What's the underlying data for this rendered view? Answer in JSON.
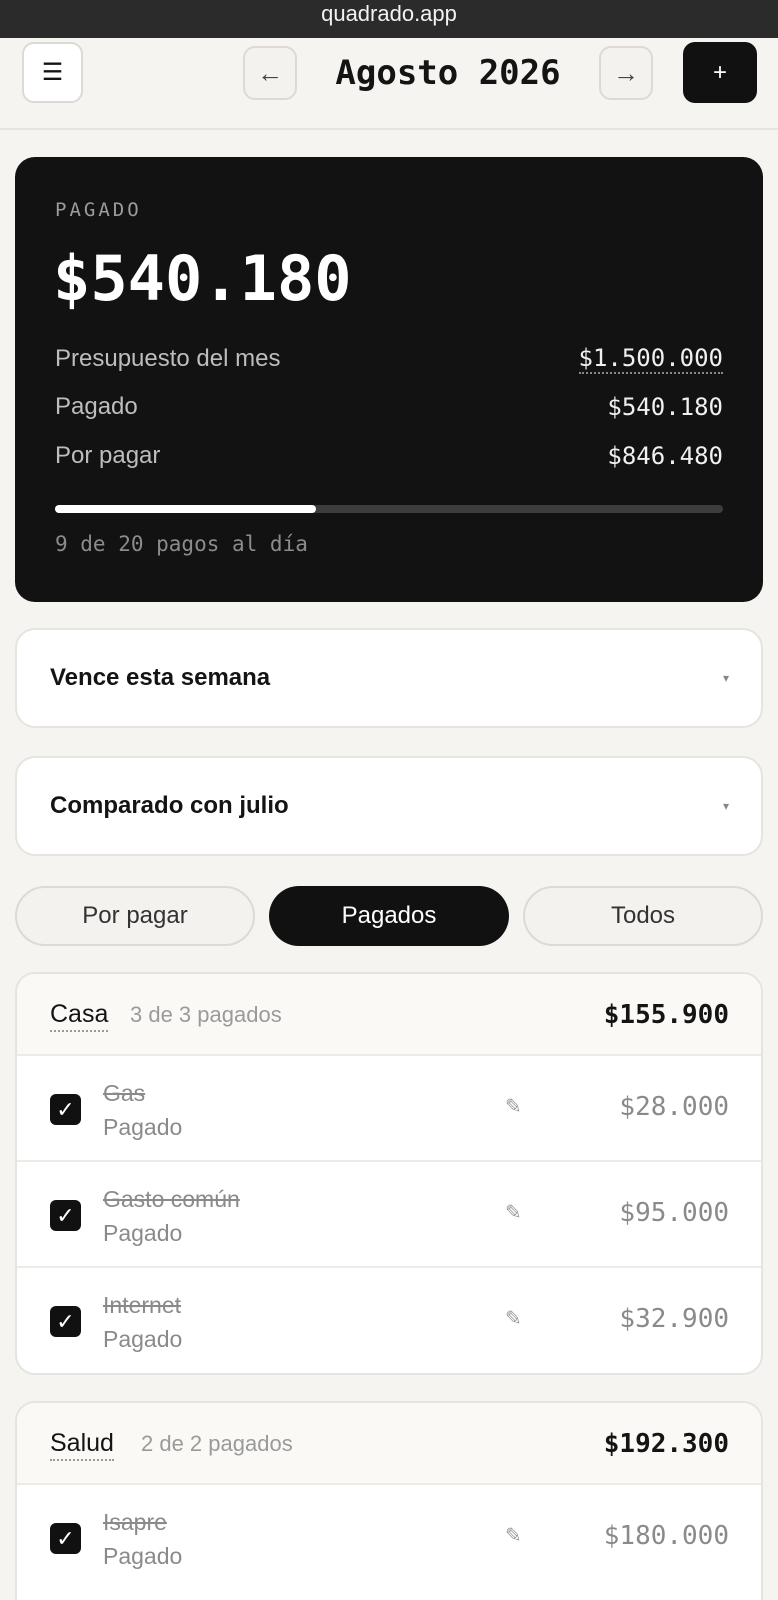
{
  "browser": {
    "url": "quadrado.app"
  },
  "header": {
    "menu_icon": "☰",
    "prev_icon": "←",
    "next_icon": "→",
    "add_icon": "+",
    "month_title": "Agosto 2026"
  },
  "summary": {
    "label": "PAGADO",
    "amount": "$540.180",
    "rows": [
      {
        "label": "Presupuesto del mes",
        "value": "$1.500.000"
      },
      {
        "label": "Pagado",
        "value": "$540.180"
      },
      {
        "label": "Por pagar",
        "value": "$846.480"
      }
    ],
    "progress_fraction": 0.39,
    "footer": "9 de 20 pagos al día"
  },
  "sections": [
    {
      "title": "Vence esta semana",
      "caret": "▾"
    },
    {
      "title": "Comparado con julio",
      "caret": "▾"
    }
  ],
  "tabs": [
    {
      "label": "Por pagar",
      "active": false
    },
    {
      "label": "Pagados",
      "active": true
    },
    {
      "label": "Todos",
      "active": false
    }
  ],
  "groups": [
    {
      "name": "Casa",
      "count": "3 de 3 pagados",
      "total": "$155.900",
      "items": [
        {
          "name": "Gas",
          "status": "Pagado",
          "amount": "$28.000"
        },
        {
          "name": "Gasto común",
          "status": "Pagado",
          "amount": "$95.000"
        },
        {
          "name": "Internet",
          "status": "Pagado",
          "amount": "$32.900"
        }
      ]
    },
    {
      "name": "Salud",
      "count": "2 de 2 pagados",
      "total": "$192.300",
      "items": [
        {
          "name": "Isapre",
          "status": "Pagado",
          "amount": "$180.000"
        }
      ]
    }
  ],
  "icons": {
    "check": "✓",
    "edit": "✎"
  },
  "colors": {
    "dark": "#121212",
    "background": "#f5f4f0",
    "muted": "#8a8a8a"
  }
}
